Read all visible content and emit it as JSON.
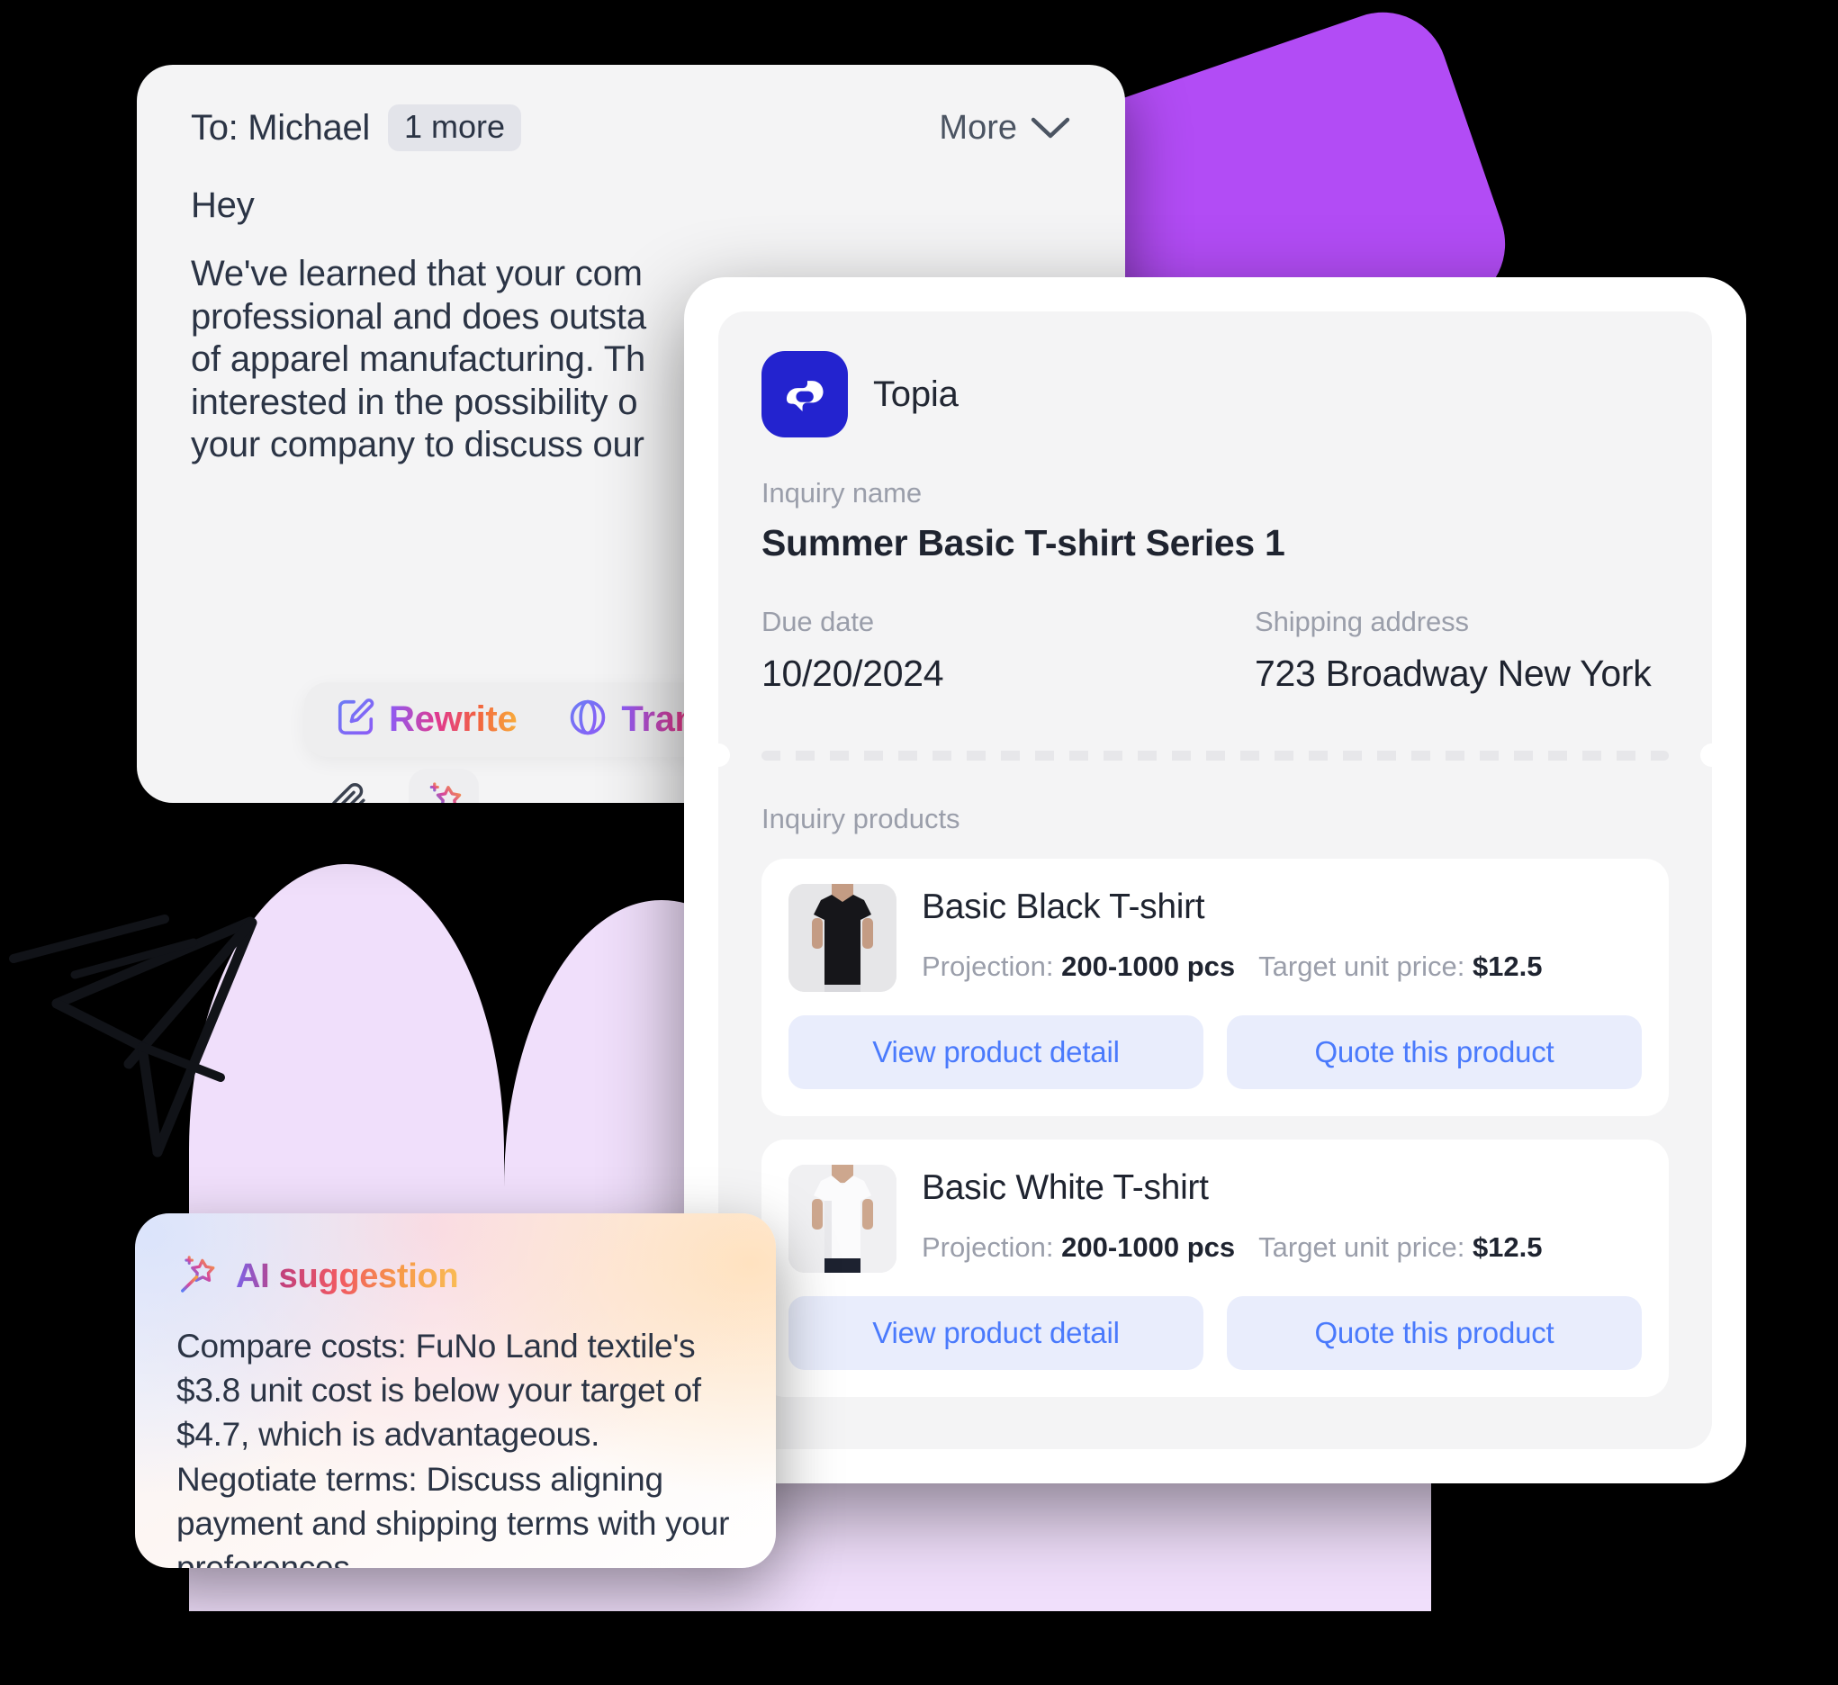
{
  "email": {
    "to_label": "To: Michael",
    "more_recipients_badge": "1 more",
    "more_toggle_label": "More",
    "greeting": "Hey",
    "paragraph": "We've learned that your com\nprofessional and does outsta\nof apparel manufacturing. Th\ninterested in the possibility o\nyour company to discuss our",
    "toolbar": {
      "rewrite_label": "Rewrite",
      "translate_label": "Translate"
    },
    "attach_icon": "paperclip-icon",
    "magic_icon": "magic-wand-icon",
    "chevron_icon": "chevron-down-icon"
  },
  "topia": {
    "brand_name": "Topia",
    "logo_color": "#2323cf",
    "inquiry_name_label": "Inquiry name",
    "inquiry_name_value": "Summer Basic T-shirt Series 1",
    "due_date_label": "Due date",
    "due_date_value": "10/20/2024",
    "shipping_label": "Shipping address",
    "shipping_value": "723 Broadway New York",
    "products_label": "Inquiry products",
    "spec_projection_label": "Projection:",
    "spec_price_label": "Target unit price:",
    "view_detail_label": "View product detail",
    "quote_label": "Quote this product",
    "accent_button_bg": "#e9edfc",
    "accent_button_text": "#4a7afc",
    "products": [
      {
        "name": "Basic Black T-shirt",
        "projection": "200-1000 pcs",
        "target_unit_price": "$12.5",
        "thumb": "black-tshirt-photo"
      },
      {
        "name": "Basic White T-shirt",
        "projection": "200-1000 pcs",
        "target_unit_price": "$12.5",
        "thumb": "white-tshirt-photo"
      }
    ]
  },
  "ai_suggestion": {
    "title": "AI suggestion",
    "icon": "magic-wand-icon",
    "body": "Compare costs: FuNo Land textile's $3.8 unit cost is below your target of $4.7, which is advantageous. Negotiate terms: Discuss aligning payment and shipping terms with your preferences."
  },
  "decor": {
    "purple_rect_color": "#b24cf5",
    "arch_blob_color": "#f0dffb",
    "paper_plane_icon": "paper-plane-doodle",
    "background_color": "#000000"
  }
}
